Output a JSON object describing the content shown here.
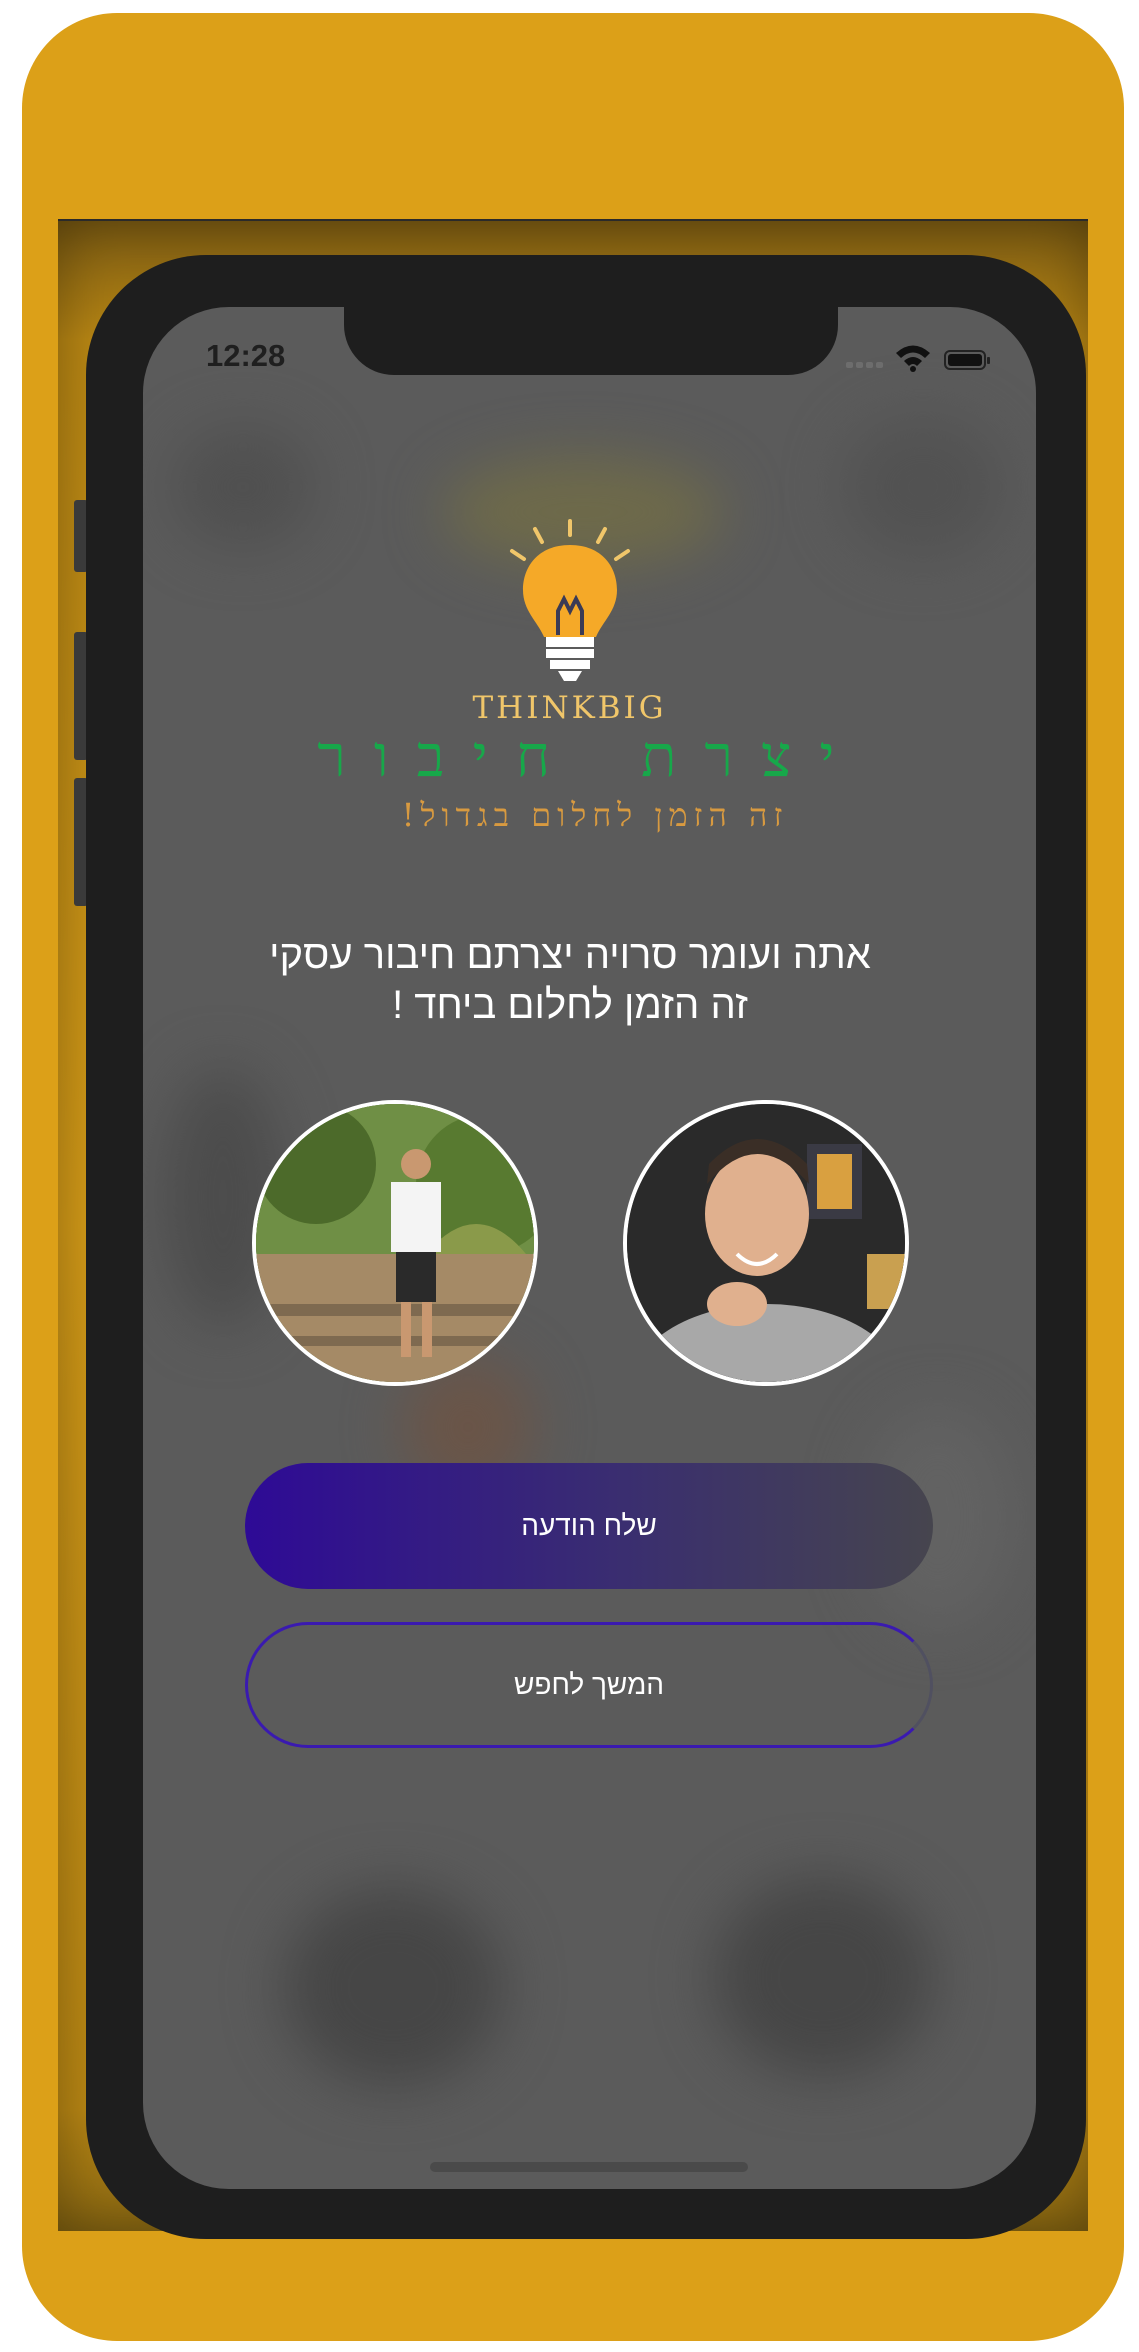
{
  "status_bar": {
    "time": "12:28"
  },
  "logo": {
    "icon": "lightbulb-icon",
    "brand": "THINKBIG"
  },
  "match": {
    "title": "יצרת חיבור",
    "subtitle": "זה הזמן לחלום בגדול!",
    "message_line1": "אתה ועומר סרויה יצרתם חיבור עסקי",
    "message_line2": "זה הזמן לחלום ביחד !"
  },
  "actions": {
    "send_message": "שלח הודעה",
    "keep_searching": "המשך לחפש"
  },
  "colors": {
    "background": "#dca018",
    "screen": "#5b5b5b",
    "title_green": "#17a84a",
    "subtitle_orange": "#d89a40",
    "button_purple": "#2e0a96"
  }
}
